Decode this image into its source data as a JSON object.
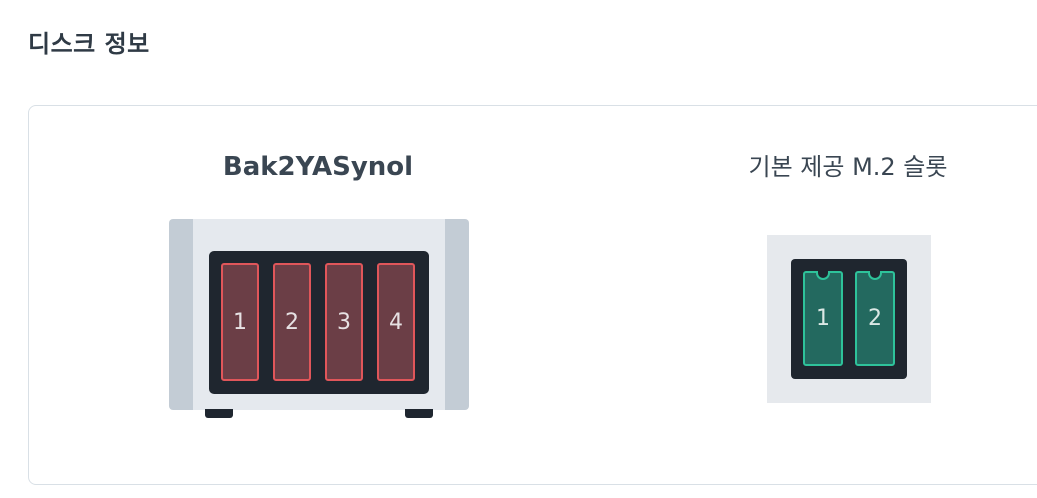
{
  "section": {
    "title": "디스크 정보"
  },
  "device": {
    "name": "Bak2YASynol",
    "drives": [
      "1",
      "2",
      "3",
      "4"
    ],
    "drive_status_color": "#e0565a"
  },
  "m2": {
    "title": "기본 제공 M.2 슬롯",
    "slots": [
      "1",
      "2"
    ],
    "slot_status_color": "#2ec29a"
  }
}
